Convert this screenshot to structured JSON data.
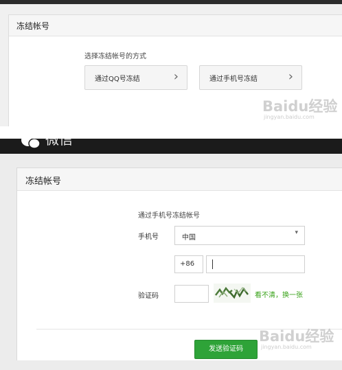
{
  "top_panel": {
    "title": "冻结帐号",
    "choose_label": "选择冻结帐号的方式",
    "options": [
      {
        "label": "通过QQ号冻结",
        "chevron": "›"
      },
      {
        "label": "通过手机号冻结",
        "chevron": "›"
      }
    ]
  },
  "watermark": {
    "brand": "Baidu经验",
    "url": "jingyan.baidu.com"
  },
  "wechat_header": {
    "app_name": "微信",
    "logo_icon": "wechat-logo-icon"
  },
  "bottom_panel": {
    "title": "冻结帐号",
    "subtitle": "通过手机号冻结帐号",
    "phone_label": "手机号",
    "country_value": "中国",
    "country_code": "+86",
    "phone_value": "",
    "code_label": "验证码",
    "code_value": "",
    "captcha_icon": "captcha-image",
    "refresh_link": "看不清，换一张",
    "send_button": "发送验证码"
  },
  "colors": {
    "accent_green": "#2ea338",
    "link_green": "#3aa31a",
    "header_dark": "#1b1b1b"
  }
}
